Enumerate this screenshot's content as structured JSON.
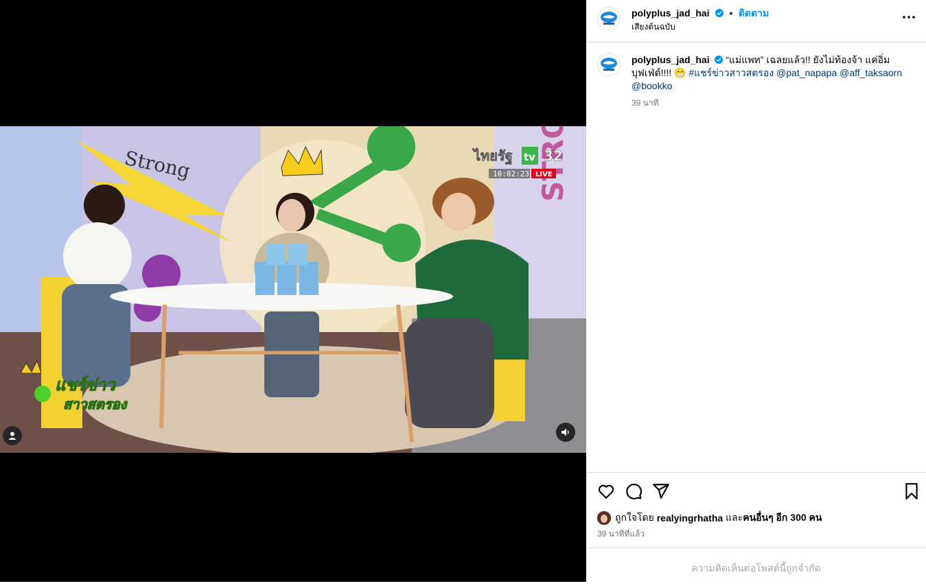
{
  "header": {
    "username": "polyplus_jad_hai",
    "follow_label": "ติดตาม",
    "separator": "•",
    "audio_label": "เสียงต้นฉบับ"
  },
  "caption": {
    "username": "polyplus_jad_hai",
    "text": "“แม่แพท” เฉลยแล้ว!! ยังไม่ท้องจ้า แค่อิ่มบุฟเฟ่ต์!!!! 😁",
    "hashtag": "#แชร์ข่าวสาวสตรอง",
    "mentions": [
      "@pat_napapa",
      "@aff_taksaorn",
      "@bookko"
    ],
    "time": "39 นาที"
  },
  "video": {
    "channel_text": "ไทยรัฐ",
    "channel_tv": "tv",
    "channel_number": "32",
    "clock": "10:02:23",
    "live_label": "LIVE",
    "show_title_line1": "แชร์ข่าว",
    "show_title_line2": "สาวสตรอง",
    "wall_text": "Strong",
    "wall_text2": "STRON"
  },
  "engagement": {
    "liked_by_prefix": "ถูกใจโดย",
    "liked_by_user": "realyingrhatha",
    "liked_by_and": "และ",
    "liked_by_rest": "คนอื่นๆ อีก 300 คน",
    "time_ago": "39 นาทีที่แล้ว"
  },
  "footer": {
    "comments_limited": "ความคิดเห็นต่อโพสต์นี้ถูกจำกัด"
  },
  "colors": {
    "accent": "#0095f6",
    "hashtag": "#00376b",
    "muted": "#737373",
    "live": "#e2001a"
  }
}
